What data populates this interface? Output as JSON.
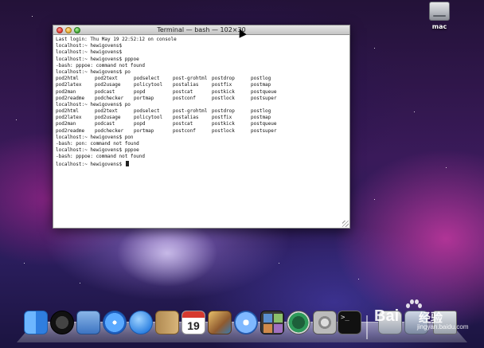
{
  "desktop": {
    "drive_label": "mac"
  },
  "terminal": {
    "title": "Terminal — bash — 102×30",
    "lines": [
      "Last login: Thu May 19 22:52:12 on console",
      "localhost:~ hewigovens$",
      "localhost:~ hewigovens$",
      "localhost:~ hewigovens$ pppoe",
      "-bash: pppoe: command not found",
      "localhost:~ hewigovens$ po"
    ],
    "completion_block_1": [
      [
        "pod2html",
        "pod2text",
        "podselect",
        "post-grohtml",
        "postdrop",
        "postlog"
      ],
      [
        "pod2latex",
        "pod2usage",
        "policytool",
        "postalias",
        "postfix",
        "postmap"
      ],
      [
        "pod2man",
        "podcast",
        "popd",
        "postcat",
        "postkick",
        "postqueue"
      ],
      [
        "pod2readme",
        "podchecker",
        "portmap",
        "postconf",
        "postlock",
        "postsuper"
      ]
    ],
    "line_after_block_1": "localhost:~ hewigovens$ po",
    "completion_block_2": [
      [
        "pod2html",
        "pod2text",
        "podselect",
        "post-grohtml",
        "postdrop",
        "postlog"
      ],
      [
        "pod2latex",
        "pod2usage",
        "policytool",
        "postalias",
        "postfix",
        "postmap"
      ],
      [
        "pod2man",
        "podcast",
        "popd",
        "postcat",
        "postkick",
        "postqueue"
      ],
      [
        "pod2readme",
        "podchecker",
        "portmap",
        "postconf",
        "postlock",
        "postsuper"
      ]
    ],
    "lines_after_block_2": [
      "localhost:~ hewigovens$ pon",
      "-bash: pon: command not found",
      "localhost:~ hewigovens$ pppoe",
      "-bash: pppoe: command not found"
    ],
    "prompt": "localhost:~ hewigovens$ "
  },
  "dock": {
    "ical_day": "19",
    "terminal_glyph": ">_"
  },
  "watermark": {
    "brand": "Bai",
    "sub": "经验",
    "url": "jingyan.baidu.com"
  }
}
